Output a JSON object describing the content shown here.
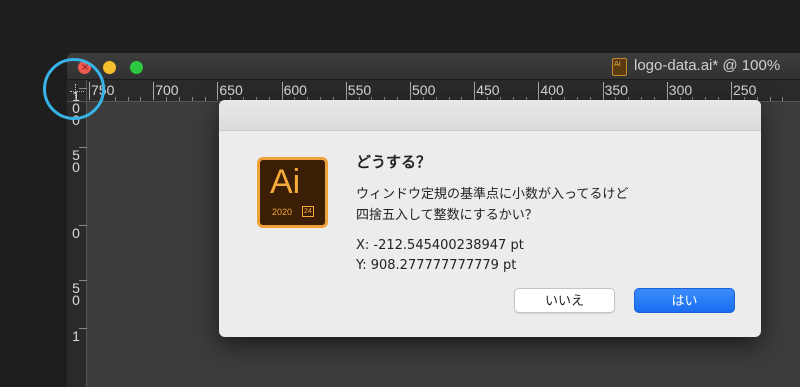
{
  "window": {
    "title": "logo-data.ai* @ 100%",
    "doc_icon_text": "Ai"
  },
  "ruler": {
    "h_labels": [
      "750",
      "700",
      "650",
      "600",
      "550",
      "500",
      "450",
      "400",
      "350",
      "300",
      "250"
    ],
    "v_labels": [
      "100",
      "50",
      "0",
      "50",
      "1"
    ]
  },
  "dialog": {
    "title": "どうする？",
    "message_line1": "ウィンドウ定規の基準点に小数が入ってるけど",
    "message_line2": "四捨五入して整数にするかい？",
    "x_value": "X: -212.545400238947 pt",
    "y_value": "Y: 908.277777777779 pt",
    "cancel_label": "いいえ",
    "ok_label": "はい",
    "app_icon": {
      "text": "Ai",
      "year": "2020",
      "version": "24"
    }
  },
  "colors": {
    "highlight": "#37b3e6",
    "primary_button": "#1a6ef0",
    "close": "#ef5b51",
    "minimize": "#f5bf2c",
    "maximize": "#2bc840"
  }
}
